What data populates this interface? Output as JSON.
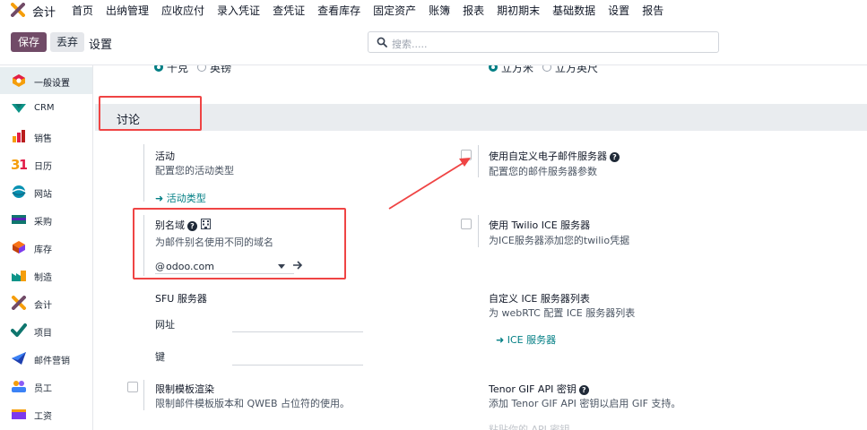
{
  "navbar": {
    "app_name": "会计",
    "menu": [
      "首页",
      "出纳管理",
      "应收应付",
      "录入凭证",
      "查凭证",
      "查看库存",
      "固定资产",
      "账簿",
      "报表",
      "期初期末",
      "基础数据",
      "设置",
      "报告"
    ]
  },
  "control_panel": {
    "save_label": "保存",
    "discard_label": "丢弃",
    "breadcrumb": "设置",
    "search_placeholder": "搜索....."
  },
  "sidebar": {
    "items": [
      {
        "label": "一般设置",
        "icon": "general-settings-icon",
        "active": true
      },
      {
        "label": "CRM",
        "icon": "crm-icon"
      },
      {
        "label": "销售",
        "icon": "sales-icon"
      },
      {
        "label": "日历",
        "icon": "calendar-icon"
      },
      {
        "label": "网站",
        "icon": "website-icon"
      },
      {
        "label": "采购",
        "icon": "purchase-icon"
      },
      {
        "label": "库存",
        "icon": "inventory-icon"
      },
      {
        "label": "制造",
        "icon": "manufacturing-icon"
      },
      {
        "label": "会计",
        "icon": "accounting-icon"
      },
      {
        "label": "项目",
        "icon": "project-icon"
      },
      {
        "label": "邮件营销",
        "icon": "email-marketing-icon"
      },
      {
        "label": "员工",
        "icon": "employees-icon"
      },
      {
        "label": "工资",
        "icon": "payroll-icon"
      }
    ]
  },
  "top_cut": {
    "left_on": "千克",
    "left_off": "英镑",
    "right_on": "立方米",
    "right_off": "立方英尺"
  },
  "section": {
    "title": "讨论",
    "activity": {
      "title": "活动",
      "desc": "配置您的活动类型",
      "link": "活动类型"
    },
    "alias": {
      "title": "别名域",
      "desc": "为邮件别名使用不同的域名",
      "prefix": "@",
      "value": "odoo.com"
    },
    "sfu": {
      "title": "SFU 服务器",
      "url_label": "网址",
      "key_label": "键"
    },
    "template": {
      "title": "限制模板渲染",
      "desc": "限制邮件模板版本和 QWEB 占位符的使用。"
    },
    "custom_mail": {
      "title": "使用自定义电子邮件服务器",
      "desc": "配置您的邮件服务器参数"
    },
    "twilio": {
      "title": "使用 Twilio ICE 服务器",
      "desc": "为ICE服务器添加您的twilio凭据"
    },
    "ice_list": {
      "title": "自定义 ICE 服务器列表",
      "desc": "为 webRTC 配置 ICE 服务器列表",
      "link": "ICE 服务器"
    },
    "tenor": {
      "title": "Tenor GIF API 密钥",
      "desc": "添加 Tenor GIF API 密钥以启用 GIF 支持。",
      "placeholder": "粘贴你的 API 密钥"
    }
  },
  "colors": {
    "brand": "#714b67",
    "link": "#017e84",
    "annotation": "#ef4444"
  }
}
